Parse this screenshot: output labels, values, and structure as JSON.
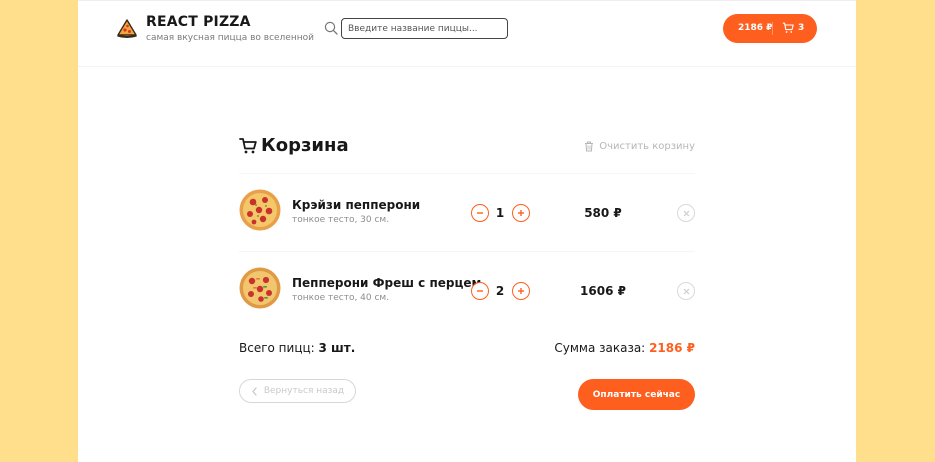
{
  "header": {
    "logo_title": "REACT PIZZA",
    "logo_subtitle": "самая вкусная пицца во вселенной",
    "search_placeholder": "Введите название пиццы...",
    "cart_price": "2186 ₽",
    "cart_count": "3"
  },
  "cart": {
    "title": "Корзина",
    "clear_label": "Очистить корзину",
    "items": [
      {
        "name": "Крэйзи пепперони",
        "desc": "тонкое тесто, 30 см.",
        "qty": "1",
        "price": "580 ₽"
      },
      {
        "name": "Пепперони Фреш с перцем",
        "desc": "тонкое тесто, 40 см.",
        "qty": "2",
        "price": "1606 ₽"
      }
    ],
    "total_count_label": "Всего пицц:",
    "total_count_value": "3 шт.",
    "total_sum_label": "Сумма заказа:",
    "total_sum_value": "2186 ₽",
    "back_label": "Вернуться назад",
    "pay_label": "Оплатить сейчас"
  },
  "colors": {
    "accent": "#FE5F1E",
    "page_background": "#FFDF8C"
  },
  "icons": {
    "logo": "pizza-logo-icon",
    "search": "search-icon",
    "cart": "cart-icon",
    "trash": "trash-icon",
    "minus": "minus-icon",
    "plus": "plus-icon",
    "remove": "close-icon",
    "back": "chevron-left-icon"
  }
}
